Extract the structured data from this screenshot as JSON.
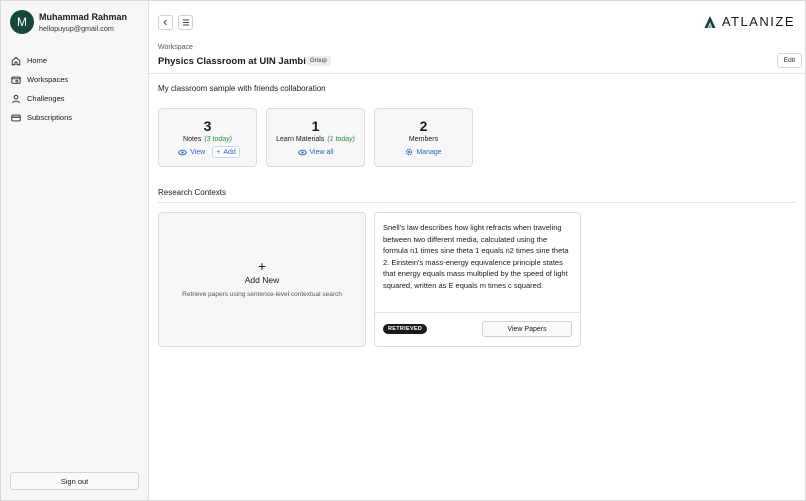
{
  "user": {
    "initial": "M",
    "name": "Muhammad Rahman",
    "email": "hellopuyup@gmail.com"
  },
  "nav": [
    {
      "label": "Home",
      "icon": "home-icon"
    },
    {
      "label": "Workspaces",
      "icon": "workspaces-icon"
    },
    {
      "label": "Challenges",
      "icon": "challenges-icon"
    },
    {
      "label": "Subscriptions",
      "icon": "card-icon"
    }
  ],
  "sign_out": "Sign out",
  "brand": {
    "name": "ATLANIZE",
    "color": "#1a3d3a"
  },
  "workspace": {
    "label": "Workspace",
    "title": "Physics Classroom at UIN Jambi",
    "badge": "Group",
    "edit": "Edit",
    "description": "My classroom sample with friends collaboration"
  },
  "stats": {
    "notes": {
      "count": "3",
      "label": "Notes",
      "today": "(3 today)",
      "view": "View",
      "add": "Add"
    },
    "materials": {
      "count": "1",
      "label": "Learn Materials",
      "today": "(1 today)",
      "view_all": "View all"
    },
    "members": {
      "count": "2",
      "label": "Members",
      "manage": "Manage"
    }
  },
  "research": {
    "title": "Research Contexts",
    "add_new": {
      "title": "Add New",
      "subtitle": "Retrieve papers using sentence-level contextual search"
    },
    "context_card": {
      "text": "Snell's law describes how light refracts when traveling between two different media, calculated using the formula n1 times sine theta 1 equals n2 times sine theta 2. Einstein's mass-energy equivalence principle states that energy equals mass multiplied by the speed of light squared, written as E equals m times c squared.",
      "status": "RETRIEVED",
      "button": "View Papers"
    }
  },
  "colors": {
    "accent_link": "#2a66c9",
    "today_green": "#2e8b3e",
    "avatar_bg": "#17473c"
  }
}
